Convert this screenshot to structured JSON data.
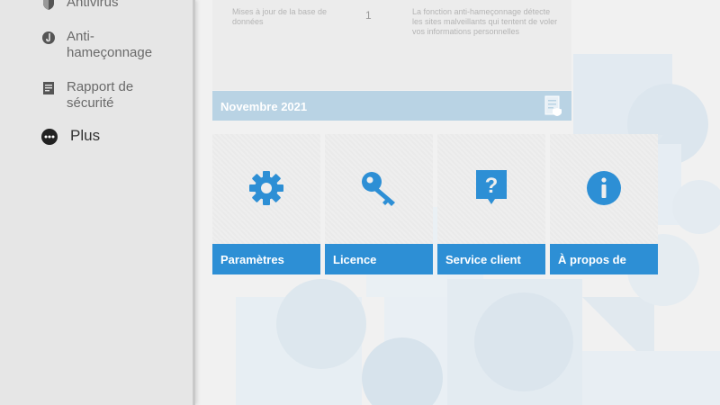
{
  "sidebar": {
    "items": [
      {
        "label": "Antivirus",
        "icon": "shield-icon"
      },
      {
        "label": "Anti-hameçonnage",
        "icon": "hook-icon"
      },
      {
        "label": "Rapport de sécurité",
        "icon": "report-icon"
      },
      {
        "label": "Plus",
        "icon": "more-icon",
        "active": true
      }
    ]
  },
  "info_panel": {
    "label": "Mises à jour de la base de données",
    "value": "1",
    "description": "La fonction anti-hameçonnage détecte les sites malveillants qui tentent de voler vos informations personnelles"
  },
  "month_bar": {
    "title": "Novembre 2021",
    "icon": "document-shield-icon"
  },
  "tiles": [
    {
      "label": "Paramètres",
      "icon": "gear-icon"
    },
    {
      "label": "Licence",
      "icon": "key-icon"
    },
    {
      "label": "Service client",
      "icon": "help-icon"
    },
    {
      "label": "À propos de",
      "icon": "info-icon"
    }
  ],
  "colors": {
    "accent": "#2d8fd5",
    "month_bar": "#b9d3e4",
    "sidebar": "#e6e6e6"
  }
}
